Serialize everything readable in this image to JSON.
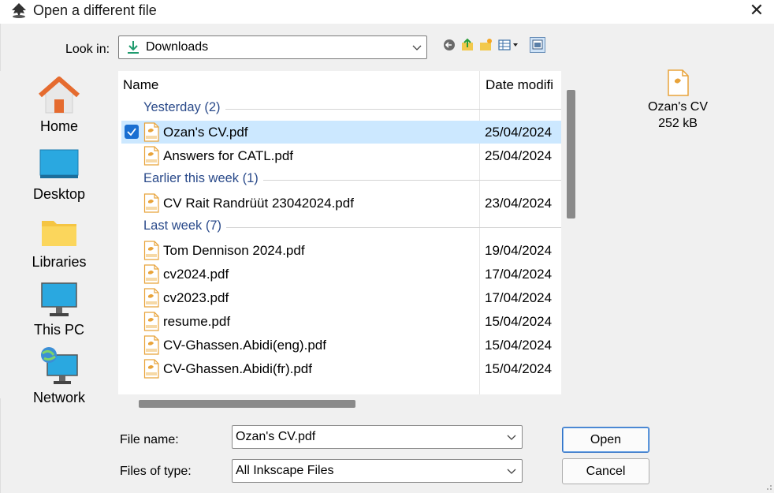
{
  "window": {
    "title": "Open a different file",
    "close_glyph": "✕"
  },
  "lookin": {
    "label": "Look in:",
    "value": "Downloads",
    "icon": "download-arrow-icon"
  },
  "toolbar": [
    "back-icon",
    "up-folder-icon",
    "new-folder-icon",
    "view-menu-icon",
    "preview-toggle-icon"
  ],
  "places": [
    {
      "label": "Home",
      "icon": "home-icon"
    },
    {
      "label": "Desktop",
      "icon": "desktop-icon"
    },
    {
      "label": "Libraries",
      "icon": "libraries-icon"
    },
    {
      "label": "This PC",
      "icon": "this-pc-icon"
    },
    {
      "label": "Network",
      "icon": "network-icon"
    }
  ],
  "list": {
    "columns": {
      "name": "Name",
      "date": "Date modifi"
    },
    "groups": [
      {
        "label": "Yesterday (2)",
        "files": [
          {
            "name": "Ozan's CV.pdf",
            "date": "25/04/2024",
            "selected": true
          },
          {
            "name": "Answers for CATL.pdf",
            "date": "25/04/2024"
          }
        ]
      },
      {
        "label": "Earlier this week (1)",
        "files": [
          {
            "name": "CV Rait Randrüüt 23042024.pdf",
            "date": "23/04/2024"
          }
        ]
      },
      {
        "label": "Last week (7)",
        "files": [
          {
            "name": "Tom Dennison 2024.pdf",
            "date": "19/04/2024"
          },
          {
            "name": "cv2024.pdf",
            "date": "17/04/2024"
          },
          {
            "name": "cv2023.pdf",
            "date": "17/04/2024"
          },
          {
            "name": "resume.pdf",
            "date": "15/04/2024"
          },
          {
            "name": "CV-Ghassen.Abidi(eng).pdf",
            "date": "15/04/2024"
          },
          {
            "name": "CV-Ghassen.Abidi(fr).pdf",
            "date": "15/04/2024"
          }
        ]
      }
    ]
  },
  "preview": {
    "name": "Ozan's CV",
    "size": "252 kB"
  },
  "filename": {
    "label": "File name:",
    "value": "Ozan's CV.pdf"
  },
  "filetype": {
    "label": "Files of type:",
    "value": "All Inkscape Files"
  },
  "buttons": {
    "open": "Open",
    "cancel": "Cancel"
  },
  "colors": {
    "selection": "#cce8ff",
    "group_text": "#2a4a8a",
    "accent": "#1a6fd1",
    "pdf_icon": "#e8a33a"
  }
}
